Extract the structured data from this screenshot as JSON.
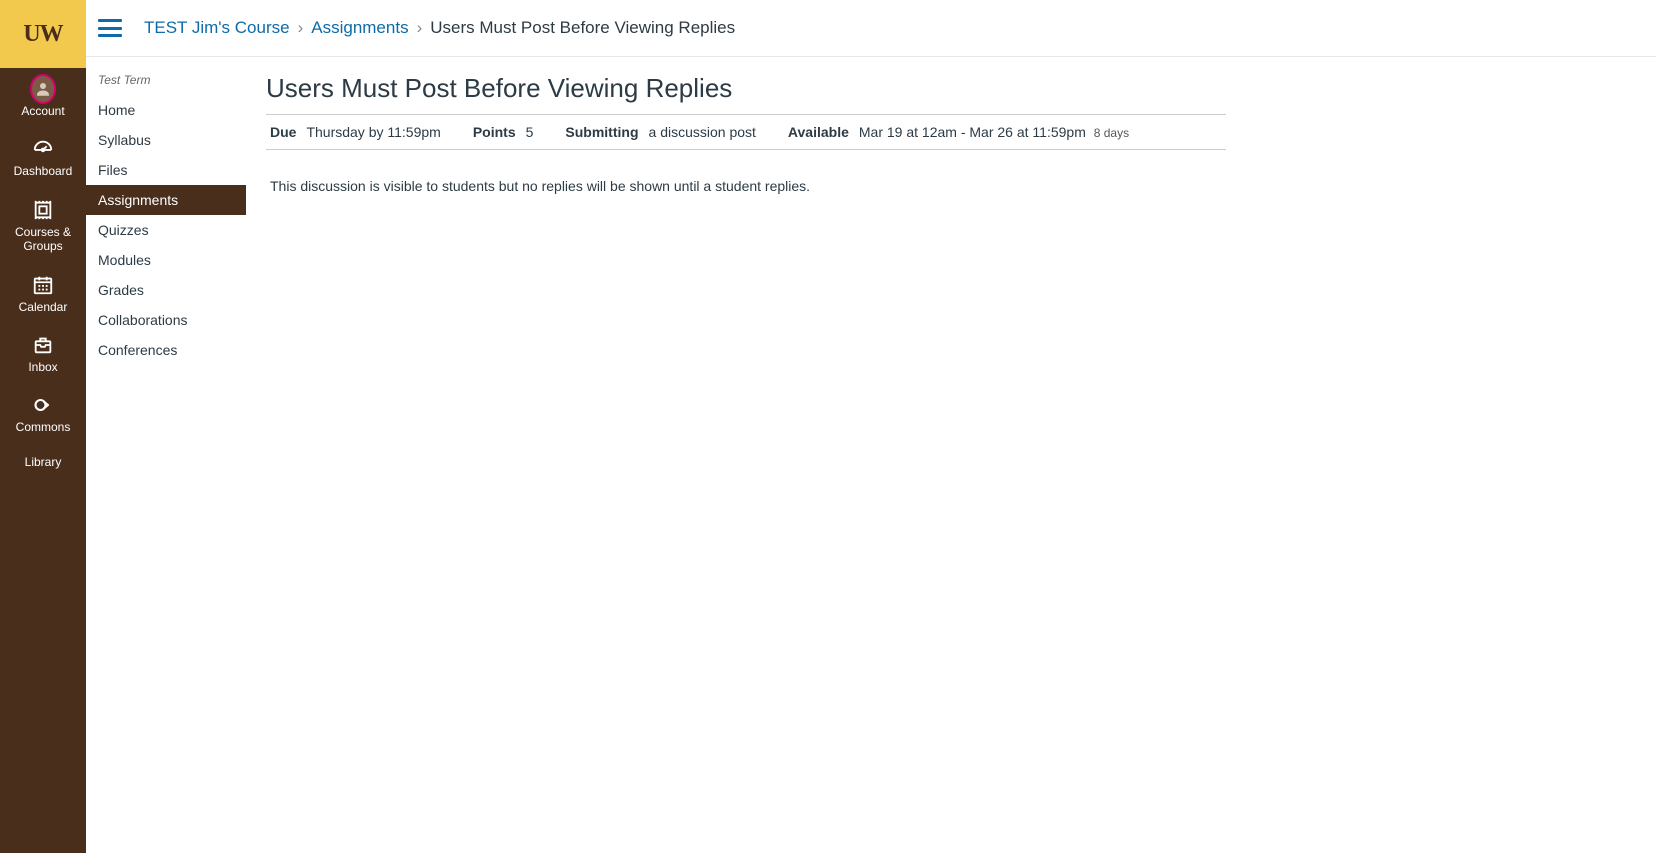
{
  "logo": "UW",
  "globalNav": {
    "account": "Account",
    "dashboard": "Dashboard",
    "courses": "Courses & Groups",
    "calendar": "Calendar",
    "inbox": "Inbox",
    "commons": "Commons",
    "library": "Library"
  },
  "breadcrumb": {
    "course": "TEST Jim's Course",
    "section": "Assignments",
    "page": "Users Must Post Before Viewing Replies"
  },
  "courseNav": {
    "term": "Test Term",
    "items": [
      "Home",
      "Syllabus",
      "Files",
      "Assignments",
      "Quizzes",
      "Modules",
      "Grades",
      "Collaborations",
      "Conferences"
    ],
    "activeIndex": 3
  },
  "assignment": {
    "title": "Users Must Post Before Viewing Replies",
    "dueLabel": "Due",
    "dueValue": "Thursday by 11:59pm",
    "pointsLabel": "Points",
    "pointsValue": "5",
    "submittingLabel": "Submitting",
    "submittingValue": "a discussion post",
    "availableLabel": "Available",
    "availableValue": "Mar 19 at 12am - Mar 26 at 11:59pm",
    "availableExtra": "8 days",
    "description": "This discussion is visible to students but no replies will be shown until a student replies."
  }
}
